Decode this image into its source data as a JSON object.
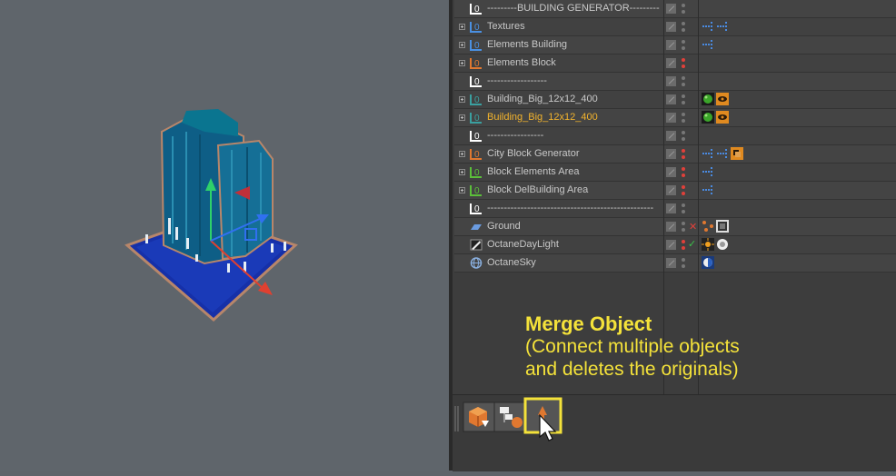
{
  "object_manager": {
    "rows": [
      {
        "label": "---------BUILDING GENERATOR---------",
        "icon": "null-object-icon",
        "icon_color": "#ffffff",
        "expandable": false,
        "highlight": false,
        "dots": [
          "gray",
          "gray"
        ],
        "tags": []
      },
      {
        "label": "Textures",
        "icon": "null-object-icon",
        "icon_color": "#4a90e2",
        "expandable": true,
        "highlight": false,
        "dots": [
          "gray",
          "gray"
        ],
        "tags": [
          "layer-dots-icon",
          "layer-dots-icon"
        ]
      },
      {
        "label": "Elements Building",
        "icon": "null-object-icon",
        "icon_color": "#4a90e2",
        "expandable": true,
        "highlight": false,
        "dots": [
          "gray",
          "gray"
        ],
        "tags": [
          "layer-dots-icon"
        ]
      },
      {
        "label": "Elements Block",
        "icon": "null-object-icon",
        "icon_color": "#e07830",
        "expandable": true,
        "highlight": false,
        "dots": [
          "red",
          "red"
        ],
        "tags": []
      },
      {
        "label": "------------------",
        "icon": "null-object-icon",
        "icon_color": "#ffffff",
        "expandable": false,
        "highlight": false,
        "dots": [
          "gray",
          "gray"
        ],
        "tags": []
      },
      {
        "label": "Building_Big_12x12_400",
        "icon": "null-object-icon",
        "icon_color": "#3aa0a0",
        "expandable": true,
        "highlight": false,
        "dots": [
          "gray",
          "gray"
        ],
        "tags": [
          "green-sphere-icon",
          "eye-tag-icon"
        ]
      },
      {
        "label": "Building_Big_12x12_400",
        "icon": "null-object-icon",
        "icon_color": "#3aa0a0",
        "expandable": true,
        "highlight": true,
        "dots": [
          "gray",
          "gray"
        ],
        "tags": [
          "green-sphere-icon",
          "eye-tag-icon"
        ]
      },
      {
        "label": "-----------------",
        "icon": "null-object-icon",
        "icon_color": "#ffffff",
        "expandable": false,
        "highlight": false,
        "dots": [
          "gray",
          "gray"
        ],
        "tags": []
      },
      {
        "label": "City Block Generator",
        "icon": "null-object-icon",
        "icon_color": "#e07830",
        "expandable": true,
        "highlight": false,
        "dots": [
          "red",
          "red"
        ],
        "tags": [
          "layer-dots-icon",
          "layer-dots-icon",
          "orange-tag-icon"
        ]
      },
      {
        "label": "Block Elements Area",
        "icon": "null-object-icon",
        "icon_color": "#5bbf3a",
        "expandable": true,
        "highlight": false,
        "dots": [
          "red",
          "red"
        ],
        "tags": [
          "layer-dots-icon"
        ]
      },
      {
        "label": "Block DelBuilding Area",
        "icon": "null-object-icon",
        "icon_color": "#5bbf3a",
        "expandable": true,
        "highlight": false,
        "dots": [
          "red",
          "red"
        ],
        "tags": [
          "layer-dots-icon"
        ]
      },
      {
        "label": "--------------------------------------------------",
        "icon": "null-object-icon",
        "icon_color": "#ffffff",
        "expandable": false,
        "highlight": false,
        "dots": [
          "gray",
          "gray"
        ],
        "tags": []
      },
      {
        "label": "Ground",
        "icon": "plane-icon",
        "icon_color": "#6a9be0",
        "expandable": false,
        "highlight": false,
        "dots": [
          "gray",
          "gray"
        ],
        "status": "x",
        "tags": [
          "vertex-tag-icon",
          "texture-tag-icon"
        ]
      },
      {
        "label": "OctaneDayLight",
        "icon": "daylight-icon",
        "icon_color": "#cccccc",
        "expandable": false,
        "highlight": false,
        "dots": [
          "red",
          "red"
        ],
        "status": "check",
        "tags": [
          "sun-tag-icon",
          "gear-tag-icon"
        ]
      },
      {
        "label": "OctaneSky",
        "icon": "sky-sphere-icon",
        "icon_color": "#8ab0e0",
        "expandable": false,
        "highlight": false,
        "dots": [
          "gray",
          "gray"
        ],
        "tags": [
          "sky-tag-icon"
        ]
      }
    ]
  },
  "annotation": {
    "title": "Merge Object",
    "line1": "(Connect multiple objects",
    "line2": "and deletes the originals)"
  },
  "toolbar": {
    "buttons": [
      "connect-delete-icon",
      "connect-objects-icon",
      "merge-object-icon"
    ],
    "selected": "merge-object-icon"
  },
  "colors": {
    "accent": "#f4e23a",
    "highlight_text": "#f2b32d"
  }
}
